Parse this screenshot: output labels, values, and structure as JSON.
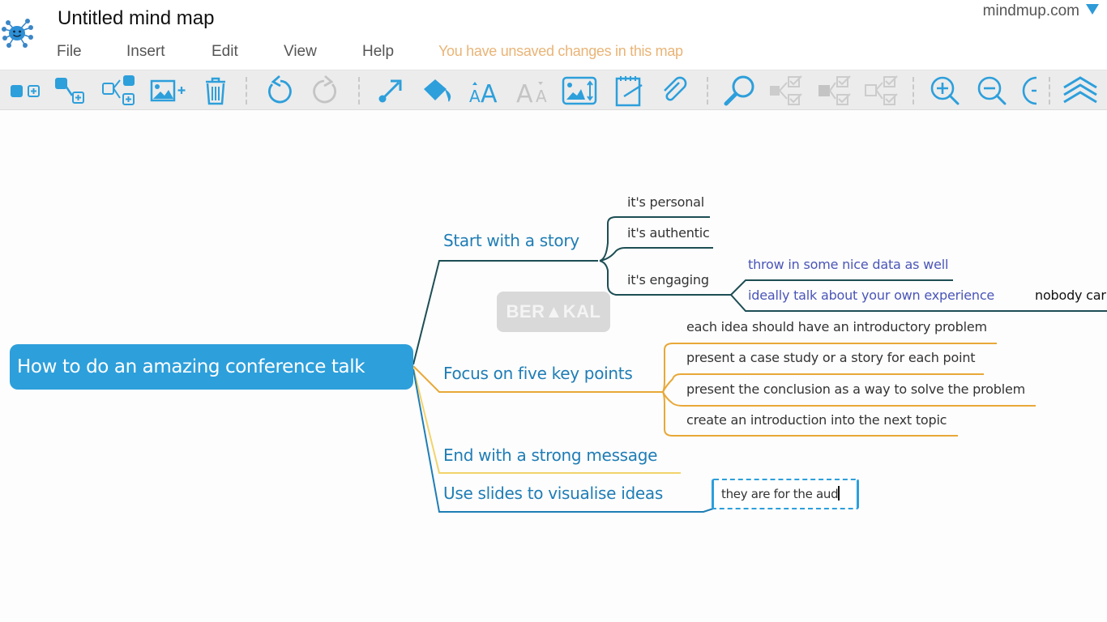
{
  "header": {
    "title": "Untitled mind map",
    "account": "mindmup.com",
    "unsaved_message": "You have unsaved changes in this map",
    "menu": [
      "File",
      "Insert",
      "Edit",
      "View",
      "Help"
    ]
  },
  "toolbar": {
    "buttons": [
      {
        "icon": "add-sibling-icon",
        "enabled": true
      },
      {
        "icon": "add-child-icon",
        "enabled": true
      },
      {
        "icon": "add-branch-icon",
        "enabled": true
      },
      {
        "icon": "insert-image-icon",
        "enabled": true
      },
      {
        "icon": "trash-icon",
        "enabled": true
      },
      {
        "icon": "undo-icon",
        "enabled": true
      },
      {
        "icon": "redo-icon",
        "enabled": false
      },
      {
        "icon": "connect-icon",
        "enabled": true
      },
      {
        "icon": "paint-bucket-icon",
        "enabled": true
      },
      {
        "icon": "font-increase-icon",
        "enabled": true
      },
      {
        "icon": "font-decrease-icon",
        "enabled": false
      },
      {
        "icon": "image-resize-icon",
        "enabled": true
      },
      {
        "icon": "note-icon",
        "enabled": true
      },
      {
        "icon": "attachment-icon",
        "enabled": true
      },
      {
        "icon": "search-icon",
        "enabled": true
      },
      {
        "icon": "tasks-icon",
        "enabled": false
      },
      {
        "icon": "tasks-filled-icon",
        "enabled": false
      },
      {
        "icon": "tasks-outline-icon",
        "enabled": false
      },
      {
        "icon": "zoom-in-icon",
        "enabled": true
      },
      {
        "icon": "zoom-out-icon",
        "enabled": true
      },
      {
        "icon": "collapse-icon",
        "enabled": true
      },
      {
        "icon": "chevrons-up-icon",
        "enabled": true
      }
    ]
  },
  "colors": {
    "accent": "#2d9fdb",
    "branch_story": "#1d4e54",
    "branch_focus": "#e8a838",
    "branch_end": "#f3d36b",
    "branch_slides": "#1f7db5",
    "unsaved": "#e9b477"
  },
  "mindmap": {
    "root": "How to do an amazing conference talk",
    "branches": [
      {
        "label": "Start with a story",
        "children": [
          {
            "label": "it's personal"
          },
          {
            "label": "it's authentic"
          },
          {
            "label": "it's engaging",
            "children": [
              {
                "label": "throw in some nice data as well"
              },
              {
                "label": "ideally talk about your own experience",
                "children": [
                  {
                    "label": "nobody car"
                  }
                ]
              }
            ]
          }
        ]
      },
      {
        "label": "Focus on five key points",
        "children": [
          {
            "label": "each idea should have an introductory problem"
          },
          {
            "label": "present a case study or a story for each point"
          },
          {
            "label": "present the conclusion as a way to solve the problem"
          },
          {
            "label": "create an introduction into the next topic"
          }
        ]
      },
      {
        "label": "End with a strong message"
      },
      {
        "label": "Use slides to visualise ideas",
        "editing_child": "they are for the aud"
      }
    ]
  },
  "watermark": "BER▲KAL"
}
